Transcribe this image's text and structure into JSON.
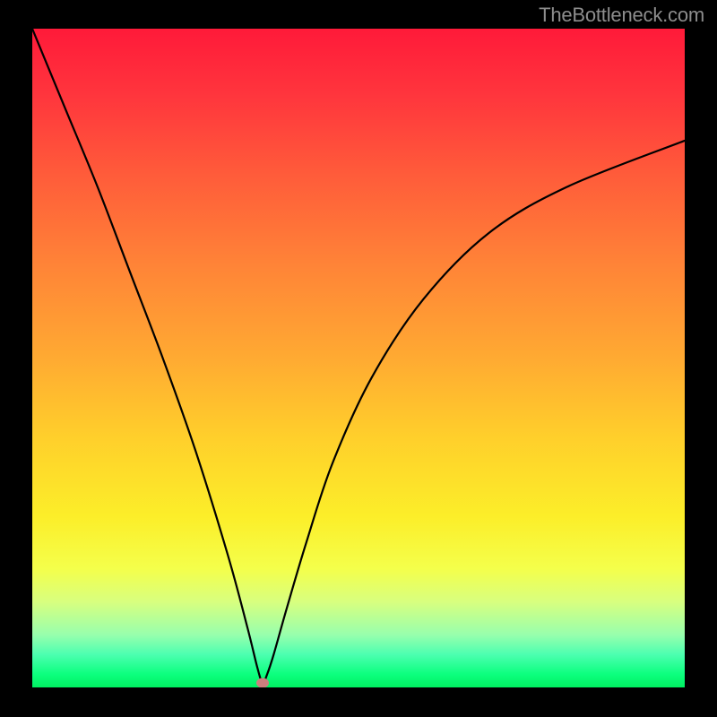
{
  "attribution": "TheBottleneck.com",
  "chart_data": {
    "type": "line",
    "title": "",
    "xlabel": "",
    "ylabel": "",
    "xlim": [
      0,
      100
    ],
    "ylim": [
      0,
      100
    ],
    "series": [
      {
        "name": "bottleneck-curve",
        "x": [
          0,
          5,
          10,
          15,
          20,
          25,
          30,
          33,
          34.5,
          35.3,
          36,
          37,
          39,
          42,
          46,
          52,
          60,
          70,
          82,
          100
        ],
        "values": [
          100,
          88,
          76,
          63,
          50,
          36,
          20,
          9,
          3,
          0.7,
          2,
          5,
          12,
          22,
          34,
          47,
          59,
          69,
          76,
          83
        ]
      }
    ],
    "marker": {
      "x": 35.3,
      "y": 0.7
    },
    "gradient_stops": [
      {
        "pct": 0,
        "color": "#ff1a39"
      },
      {
        "pct": 50,
        "color": "#ffaa32"
      },
      {
        "pct": 82,
        "color": "#f4ff4b"
      },
      {
        "pct": 100,
        "color": "#00f061"
      }
    ]
  }
}
